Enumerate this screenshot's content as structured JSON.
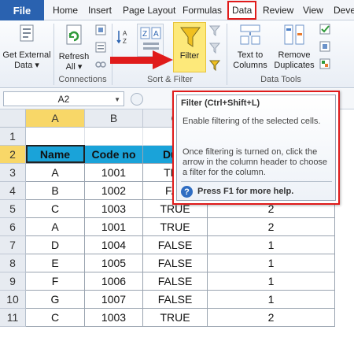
{
  "menu": {
    "file": "File",
    "tabs": [
      "Home",
      "Insert",
      "Page Layout",
      "Formulas",
      "Data",
      "Review",
      "View",
      "Deve"
    ]
  },
  "ribbon": {
    "get_external_data": "Get External Data ▾",
    "refresh_all": "Refresh All ▾",
    "connections_group": "Connections",
    "filter": "Filter",
    "sort_filter_group": "Sort & Filter",
    "text_to_columns": "Text to Columns",
    "remove_duplicates": "Remove Duplicates",
    "data_tools_group": "Data Tools"
  },
  "formula_bar": {
    "name_box": "A2"
  },
  "grid": {
    "columns": [
      "A",
      "B",
      "C"
    ],
    "rows": [
      "1",
      "2",
      "3",
      "4",
      "5",
      "6",
      "7",
      "8",
      "9",
      "10",
      "11"
    ],
    "headers": [
      "Name",
      "Code no",
      "Dupl"
    ],
    "data": [
      [
        "A",
        "1001",
        "TRU",
        ""
      ],
      [
        "B",
        "1002",
        "FAL",
        ""
      ],
      [
        "C",
        "1003",
        "TRUE",
        "2"
      ],
      [
        "A",
        "1001",
        "TRUE",
        "2"
      ],
      [
        "D",
        "1004",
        "FALSE",
        "1"
      ],
      [
        "E",
        "1005",
        "FALSE",
        "1"
      ],
      [
        "F",
        "1006",
        "FALSE",
        "1"
      ],
      [
        "G",
        "1007",
        "FALSE",
        "1"
      ],
      [
        "C",
        "1003",
        "TRUE",
        "2"
      ]
    ]
  },
  "tooltip": {
    "title": "Filter (Ctrl+Shift+L)",
    "line1": "Enable filtering of the selected cells.",
    "line2": "Once filtering is turned on, click the arrow in the column header to choose a filter for the column.",
    "help": "Press F1 for more help."
  },
  "colors": {
    "accent": "#2a62b0",
    "highlight": "#e01b1b",
    "header_fill": "#1aa3d9",
    "filter_fill": "#fde97a"
  }
}
